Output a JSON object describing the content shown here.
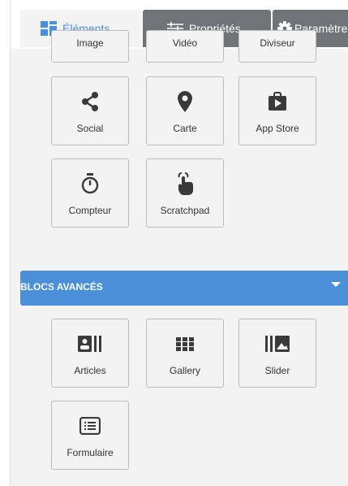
{
  "tabs": {
    "elements": "Éléments",
    "properties": "Propriétés",
    "settings": "Paramètres"
  },
  "top_cut_tiles": [
    "Image",
    "Vidéo",
    "Diviseur"
  ],
  "basic_tiles": [
    "Social",
    "Carte",
    "App Store",
    "Compteur",
    "Scratchpad"
  ],
  "advanced": {
    "title": "BLOCS AVANCÉS",
    "tiles": [
      "Articles",
      "Gallery",
      "Slider",
      "Formulaire"
    ]
  },
  "colors": {
    "accent": "#4a90d9",
    "inactive_tab": "#707378",
    "panel_bg": "#f3f3f3",
    "icon": "#3a3a3a"
  }
}
